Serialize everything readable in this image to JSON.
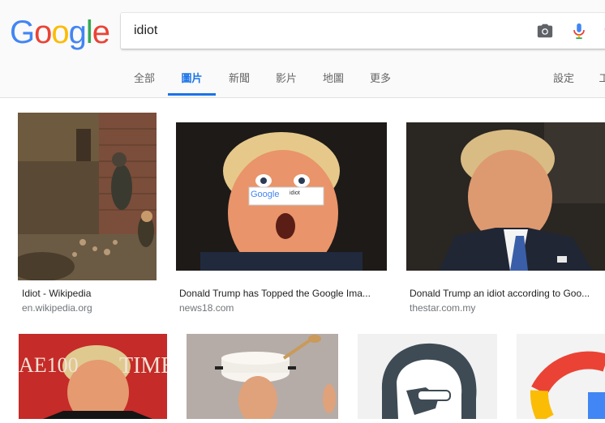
{
  "brand": {
    "logo_letters": [
      "G",
      "o",
      "o",
      "g",
      "l",
      "e"
    ],
    "logo_colors": [
      "#4285F4",
      "#EA4335",
      "#FBBC05",
      "#4285F4",
      "#34A853",
      "#EA4335"
    ]
  },
  "search": {
    "query": "idiot"
  },
  "tabs": [
    {
      "label": "全部",
      "active": false
    },
    {
      "label": "圖片",
      "active": true
    },
    {
      "label": "新聞",
      "active": false
    },
    {
      "label": "影片",
      "active": false
    },
    {
      "label": "地圖",
      "active": false
    },
    {
      "label": "更多",
      "active": false
    },
    {
      "label": "設定",
      "active": false
    },
    {
      "label": "工",
      "active": false
    }
  ],
  "results": [
    {
      "caption": "Idiot - Wikipedia",
      "source": "en.wikipedia.org"
    },
    {
      "caption": "Donald Trump has Topped the Google Ima...",
      "source": "news18.com"
    },
    {
      "caption": "Donald Trump an idiot according to Goo...",
      "source": "thestar.com.my"
    },
    {
      "caption": "",
      "source": ""
    },
    {
      "caption": "",
      "source": ""
    },
    {
      "caption": "",
      "source": ""
    },
    {
      "caption": "",
      "source": ""
    }
  ],
  "thumb_overlay": {
    "mini_logo": "Google",
    "mini_query": "idiot",
    "magazine_text": "TIME",
    "magazine_number": "AE100"
  },
  "icons": {
    "camera": "camera-icon",
    "mic": "mic-icon",
    "search": "search-icon"
  }
}
